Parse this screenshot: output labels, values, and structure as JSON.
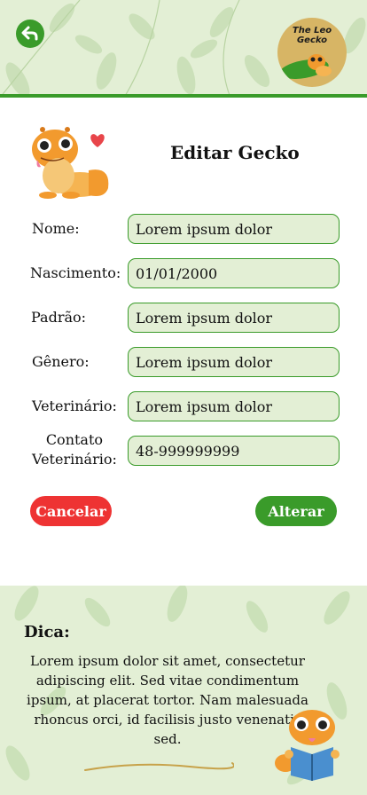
{
  "header": {
    "back_icon": "back-arrow-icon",
    "logo_line1": "The Leo",
    "logo_line2": "Gecko"
  },
  "form": {
    "title": "Editar Gecko",
    "fields": [
      {
        "label": "Nome:",
        "value": "Lorem ipsum dolor"
      },
      {
        "label": "Nascimento:",
        "value": "01/01/2000"
      },
      {
        "label": "Padrão:",
        "value": "Lorem ipsum dolor"
      },
      {
        "label": "Gênero:",
        "value": "Lorem ipsum dolor"
      },
      {
        "label": "Veterinário:",
        "value": "Lorem ipsum dolor"
      },
      {
        "label_line1": "Contato",
        "label_line2": "Veterinário:",
        "value": "48-999999999"
      }
    ],
    "cancel_label": "Cancelar",
    "save_label": "Alterar"
  },
  "tip": {
    "title": "Dica:",
    "text": "Lorem ipsum dolor sit amet, consectetur adipiscing elit. Sed vitae condimentum ipsum, at placerat tortor. Nam malesuada rhoncus orci, id facilisis justo venenatis sed."
  },
  "colors": {
    "accent_green": "#3a9b2a",
    "field_bg": "#e3efd5",
    "cancel_red": "#ee3333"
  }
}
